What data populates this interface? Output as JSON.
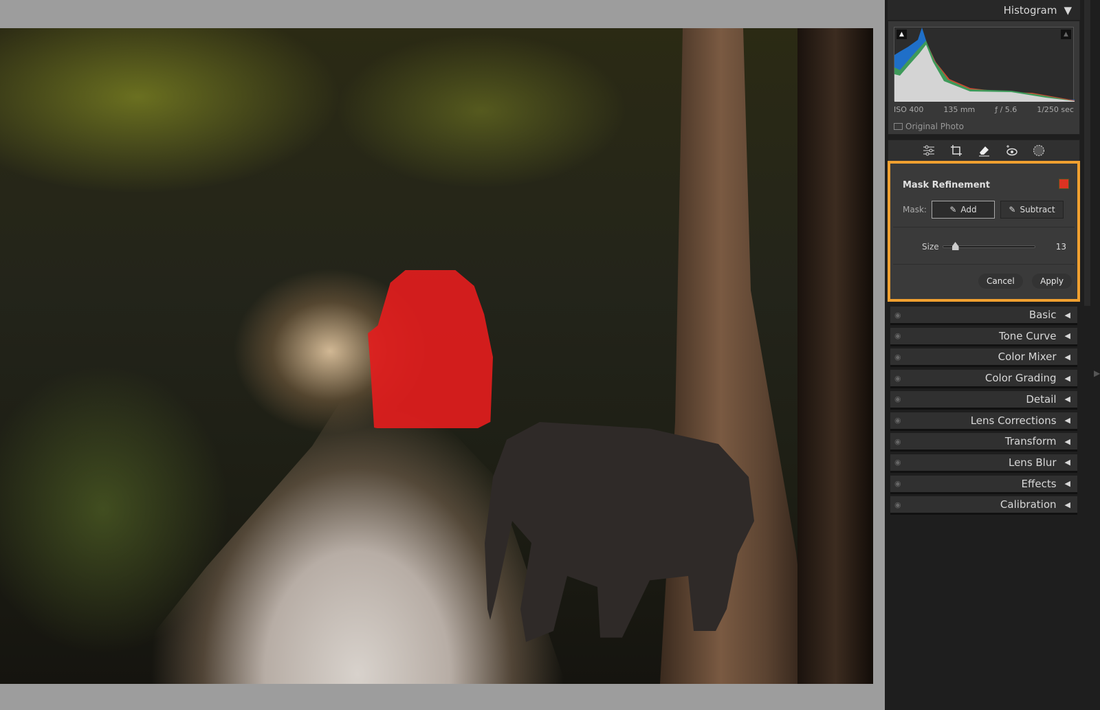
{
  "histogram": {
    "title": "Histogram",
    "exif": {
      "iso": "ISO 400",
      "focal_length": "135 mm",
      "aperture": "ƒ / 5.6",
      "shutter": "1/250 sec"
    },
    "original_photo_label": "Original Photo",
    "original_photo_checked": false
  },
  "tools": [
    "edit-sliders-icon",
    "crop-icon",
    "healing-eraser-icon",
    "red-eye-icon",
    "masking-icon"
  ],
  "mask_refinement": {
    "title": "Mask Refinement",
    "overlay_color": "#dd3322",
    "mask_label": "Mask:",
    "add_label": "Add",
    "subtract_label": "Subtract",
    "active_mode": "Add",
    "size_label": "Size",
    "size_value": "13",
    "size_fraction": 0.13,
    "cancel_label": "Cancel",
    "apply_label": "Apply"
  },
  "panels": [
    "Basic",
    "Tone Curve",
    "Color Mixer",
    "Color Grading",
    "Detail",
    "Lens Corrections",
    "Transform",
    "Lens Blur",
    "Effects",
    "Calibration"
  ],
  "accent_color": "#f0a030"
}
